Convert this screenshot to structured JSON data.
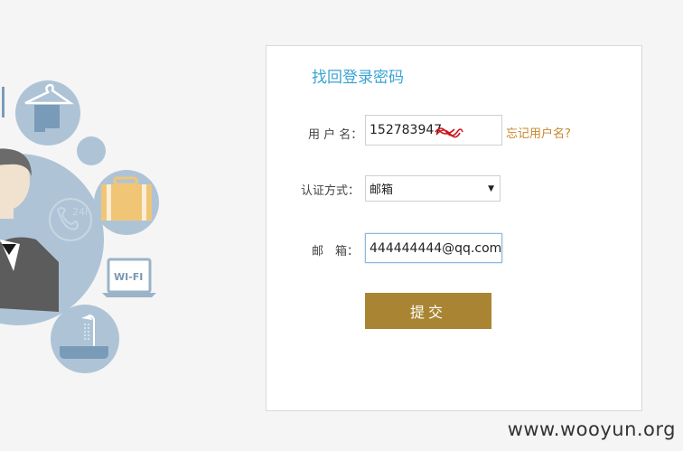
{
  "form": {
    "title": "找回登录密码",
    "username_label": "用 户 名：",
    "username_value": "152783947",
    "forgot_username_link": "忘记用户名?",
    "auth_label": "认证方式：",
    "auth_selected": "邮箱",
    "email_label": "邮　箱：",
    "email_value": "444444444@qq.com",
    "submit_label": "提交"
  },
  "illustration": {
    "wifi_text": "WI-FI",
    "phone_text": "24h"
  },
  "watermark": "www.wooyun.org",
  "colors": {
    "title": "#3aa3d3",
    "link": "#c8862a",
    "submit": "#a98533",
    "icon_circle": "#b5cfe0"
  }
}
